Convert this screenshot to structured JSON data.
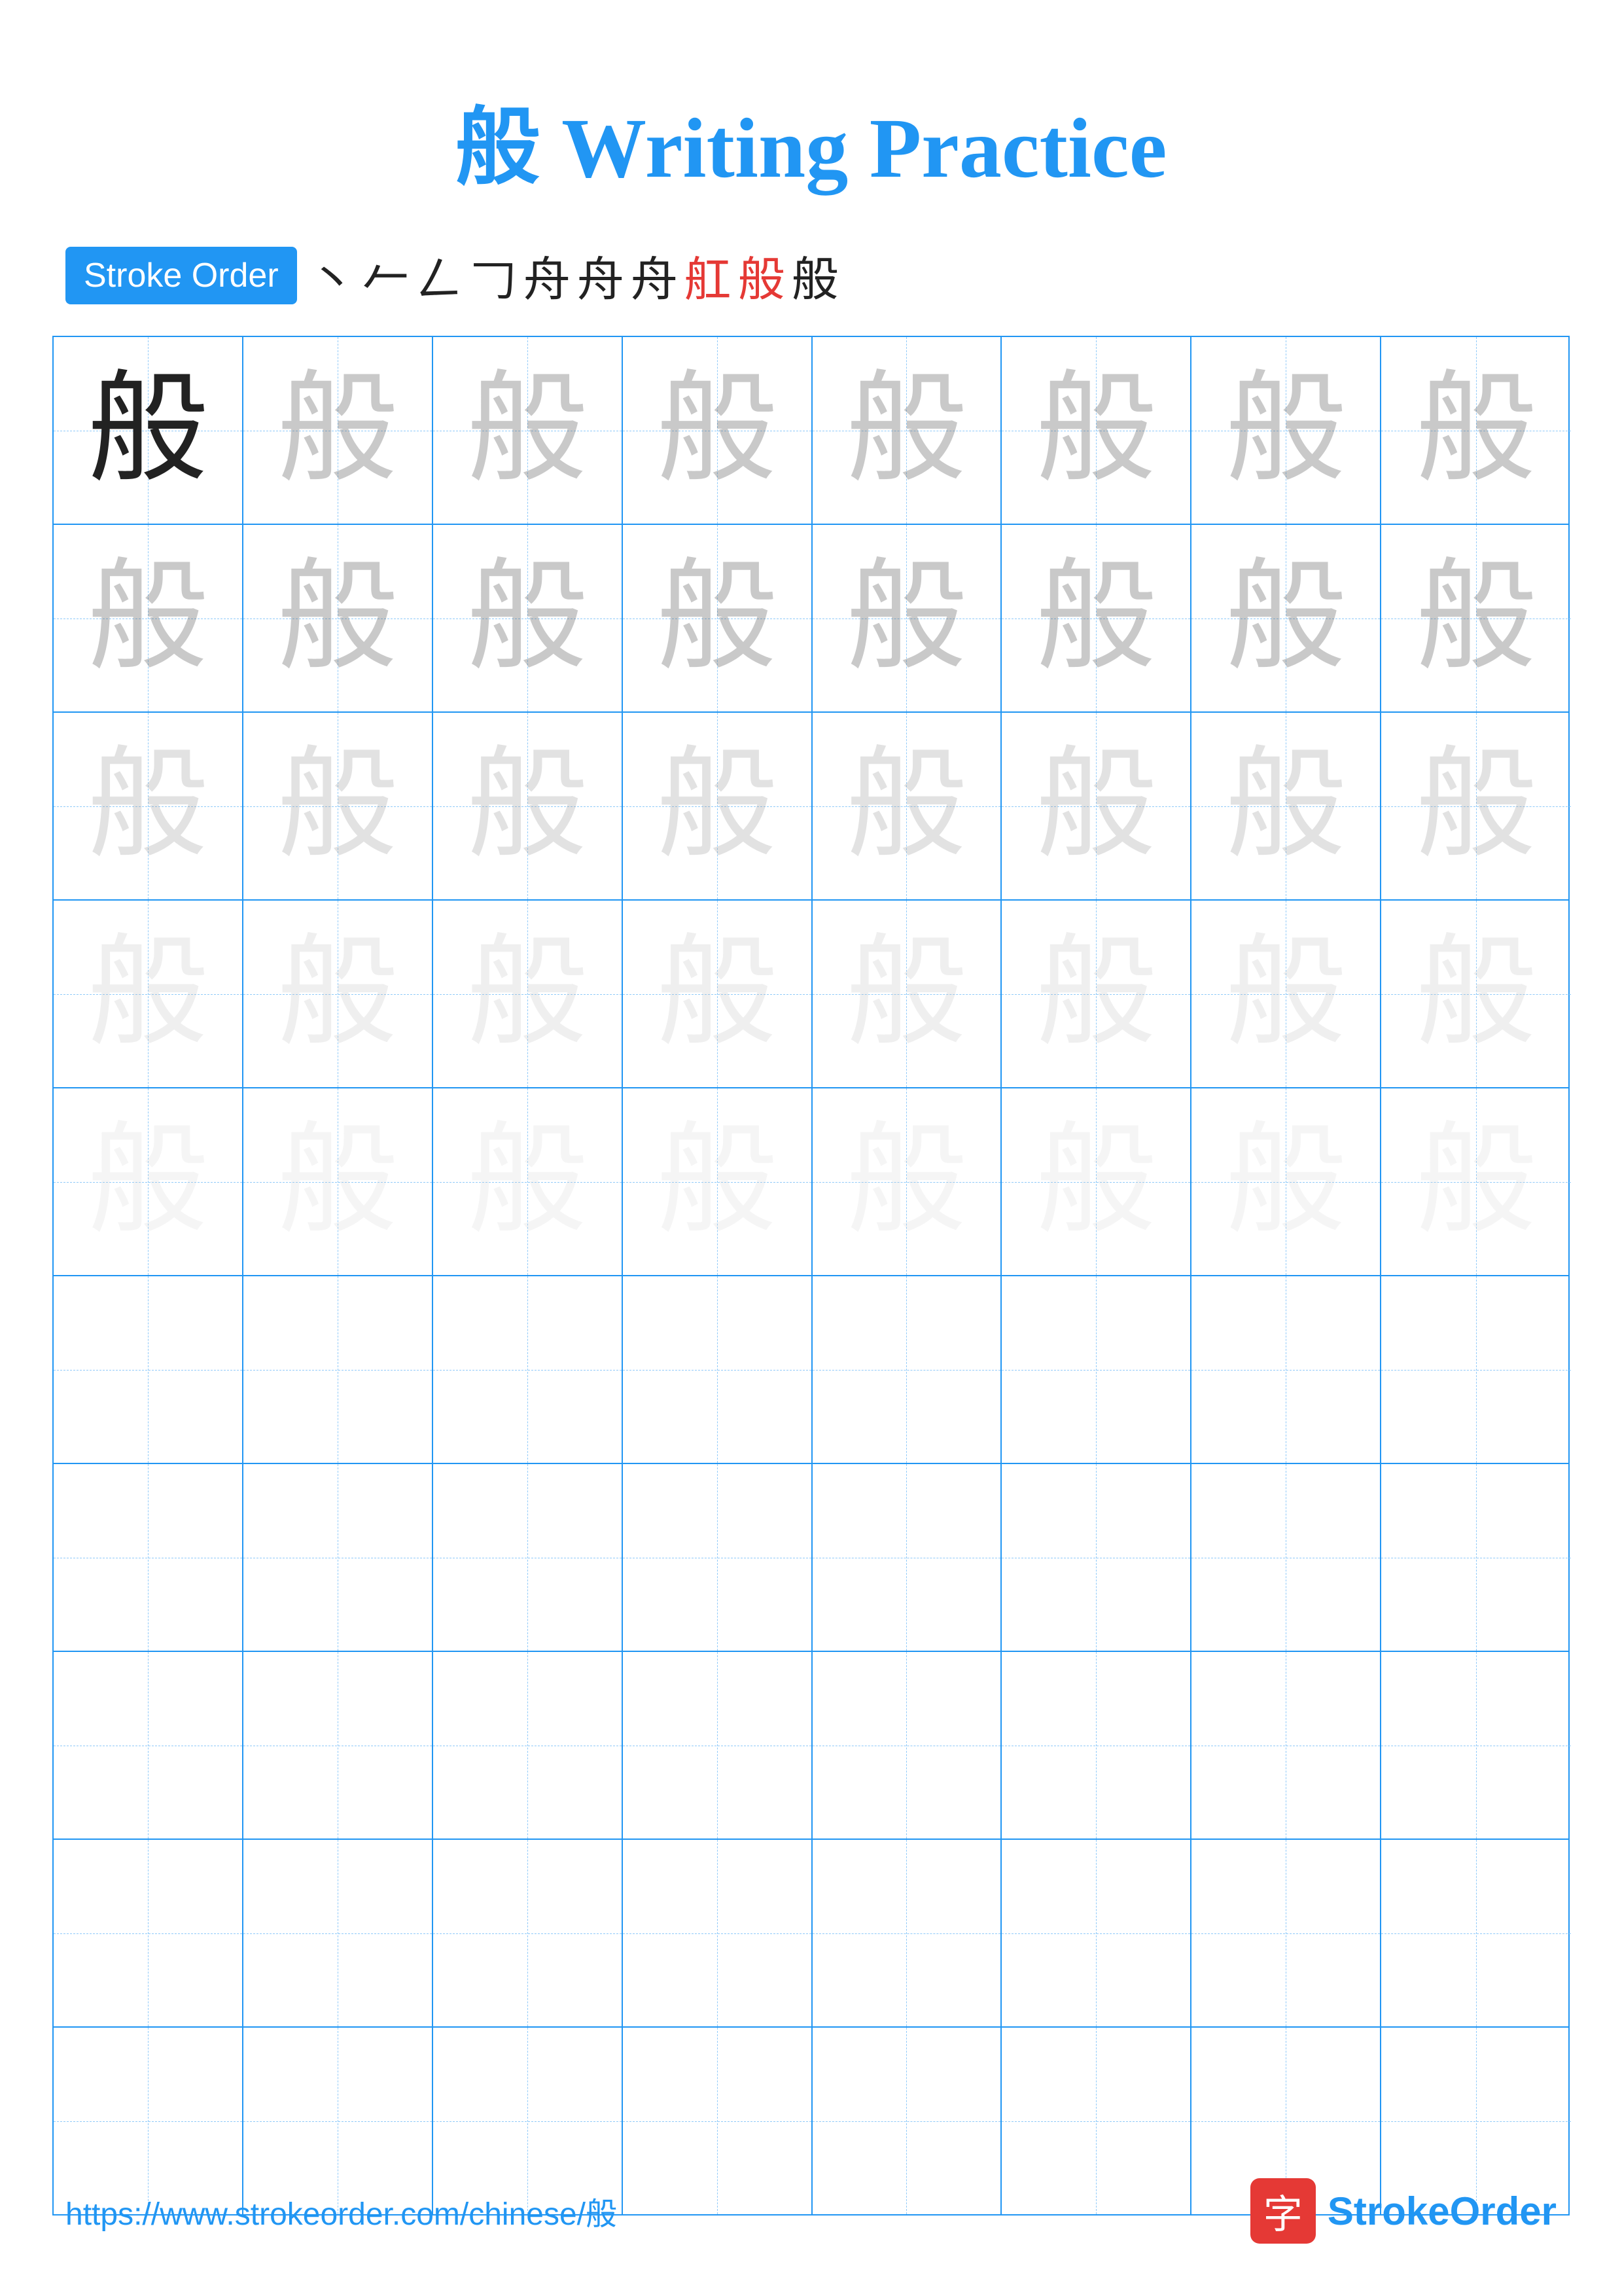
{
  "title": {
    "character": "般",
    "text": "Writing Practice",
    "full": "般 Writing Practice"
  },
  "stroke_order": {
    "badge_label": "Stroke Order",
    "strokes": [
      "丶",
      "𠂉",
      "𠃋",
      "𠃌",
      "舟",
      "舟",
      "舟",
      "舡",
      "般",
      "般"
    ]
  },
  "main_character": "般",
  "grid": {
    "rows": 10,
    "cols": 8,
    "practice_rows_start": 5,
    "colors": {
      "accent": "#2196F3",
      "dark": "#222222",
      "light1": "rgba(100,100,100,0.35)",
      "light2": "rgba(150,150,150,0.28)",
      "light3": "rgba(180,180,180,0.22)",
      "light4": "rgba(200,200,200,0.18)"
    }
  },
  "footer": {
    "url": "https://www.strokeorder.com/chinese/般",
    "logo_char": "字",
    "logo_text": "StrokeOrder"
  }
}
